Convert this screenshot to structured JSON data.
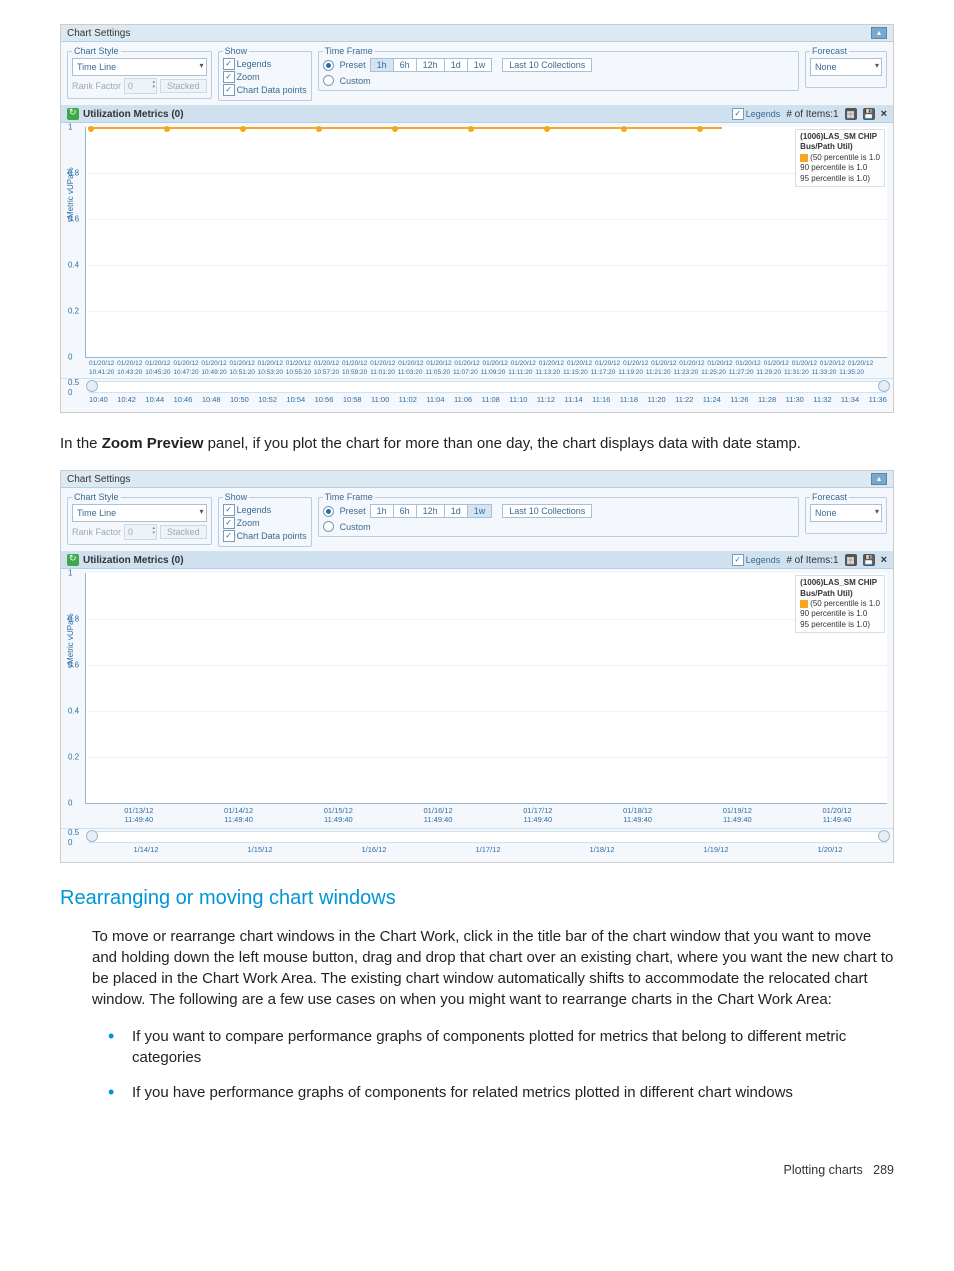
{
  "settings": {
    "panel_title": "Chart Settings",
    "group_chart_style": "Chart Style",
    "chart_style_value": "Time Line",
    "rank_factor_label": "Rank Factor",
    "rank_factor_value": "0",
    "stacked_btn": "Stacked",
    "group_show": "Show",
    "show_legends": "Legends",
    "show_zoom": "Zoom",
    "show_data_points": "Chart Data points",
    "group_time_frame": "Time Frame",
    "preset_label": "Preset",
    "custom_label": "Custom",
    "tf_buttons": [
      "1h",
      "6h",
      "12h",
      "1d",
      "1w"
    ],
    "last10": "Last 10 Collections",
    "group_forecast": "Forecast",
    "forecast_value": "None"
  },
  "metrics": {
    "title": "Utilization Metrics (0)",
    "legends_label": "Legends",
    "items_label": "# of Items:1"
  },
  "legend": {
    "title": "(1006)LAS_SM CHIP",
    "sub": "Bus/Path Util)",
    "rows": [
      "(50 percentile is 1.0",
      "90 percentile is 1.0",
      "95 percentile is 1.0)"
    ]
  },
  "chart_data": {
    "type": "line",
    "ylabel": "vMetric vUPa%",
    "ylim": [
      0,
      1
    ],
    "yticks": [
      0,
      0.2,
      0.4,
      0.6,
      0.8,
      1
    ],
    "series": [
      {
        "name": "(1006)LAS_SM CHIP Bus/Path Util)",
        "constant_value": 1.0
      }
    ]
  },
  "fig1": {
    "tf_active": "1h",
    "xtick_top": "01/20/12 01/20/12 01/20/12 01/20/12 01/20/12 01/20/12 01/20/12 01/20/12 01/20/12 01/20/12 01/20/12 01/20/12 01/20/12 01/20/12 01/20/12 01/20/12 01/20/12 01/20/12 01/20/12 01/20/12 01/20/12 01/20/12 01/20/12 01/20/12 01/20/12 01/20/12 01/20/12 01/20/12",
    "xtick_bot": "10:41:20 10:43:20 10:45:20 10:47:20 10:49:20 10:51:20 10:53:20 10:55:20 10:57:20 10:59:20 11:01:20 11:03:20 11:05:20 11:07:20 11:09:20 11:11:20 11:13:20 11:15:20 11:17:20 11:19:20 11:21:20 11:23:20 11:25:20 11:27:20 11:29:20 11:31:20 11:33:20 11:35:20",
    "zoom_y": [
      "0.5",
      "0"
    ],
    "zoom_ticks": [
      "10:40",
      "10:42",
      "10:44",
      "10:46",
      "10:48",
      "10:50",
      "10:52",
      "10:54",
      "10:56",
      "10:58",
      "11:00",
      "11:02",
      "11:04",
      "11:06",
      "11:08",
      "11:10",
      "11:12",
      "11:14",
      "11:16",
      "11:18",
      "11:20",
      "11:22",
      "11:24",
      "11:26",
      "11:28",
      "11:30",
      "11:32",
      "11:34",
      "11:36"
    ]
  },
  "caption1": {
    "pre": "In the ",
    "bold": "Zoom Preview",
    "post": " panel, if you plot the chart for more than one day, the chart displays data with date stamp."
  },
  "fig2": {
    "tf_active": "1w",
    "xticks": [
      {
        "d": "01/13/12",
        "t": "11:49:40"
      },
      {
        "d": "01/14/12",
        "t": "11:49:40"
      },
      {
        "d": "01/15/12",
        "t": "11:49:40"
      },
      {
        "d": "01/16/12",
        "t": "11:49:40"
      },
      {
        "d": "01/17/12",
        "t": "11:49:40"
      },
      {
        "d": "01/18/12",
        "t": "11:49:40"
      },
      {
        "d": "01/19/12",
        "t": "11:49:40"
      },
      {
        "d": "01/20/12",
        "t": "11:49:40"
      }
    ],
    "zoom_y": [
      "0.5",
      "0"
    ],
    "zoom_days": [
      "1/14/12",
      "1/15/12",
      "1/16/12",
      "1/17/12",
      "1/18/12",
      "1/19/12",
      "1/20/12"
    ]
  },
  "section": {
    "heading": "Rearranging or moving chart windows",
    "para": "To move or rearrange chart windows in the Chart Work, click in the title bar of the chart window that you want to move and holding down the left mouse button, drag and drop that chart over an existing chart, where you want the new chart to be placed in the Chart Work Area. The existing chart window automatically shifts to accommodate the relocated chart window. The following are a few use cases on when you might want to rearrange charts in the Chart Work Area:",
    "bullets": [
      "If you want to compare performance graphs of components plotted for metrics that belong to different metric categories",
      "If you have performance graphs of components for related metrics plotted in different chart windows"
    ]
  },
  "footer": {
    "label": "Plotting charts",
    "page": "289"
  }
}
